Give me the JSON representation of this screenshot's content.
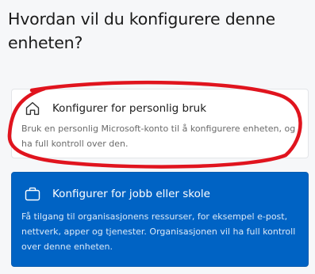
{
  "page": {
    "title": "Hvordan vil du konfigurere denne enheten?"
  },
  "options": [
    {
      "icon": "home-icon",
      "title": "Konfigurer for personlig bruk",
      "description": "Bruk en personlig Microsoft-konto til å konfigurere enheten, og ha full kontroll over den.",
      "selected": false
    },
    {
      "icon": "briefcase-icon",
      "title": "Konfigurer for jobb eller skole",
      "description": "Få tilgang til organisasjonens ressurser, for eksempel e-post, nettverk, apper og tjenester. Organisasjonen vil ha full kontroll over denne enheten.",
      "selected": true
    }
  ],
  "colors": {
    "accent": "#0063c4",
    "annotation": "#e0141e",
    "background": "#f6f7f9"
  }
}
